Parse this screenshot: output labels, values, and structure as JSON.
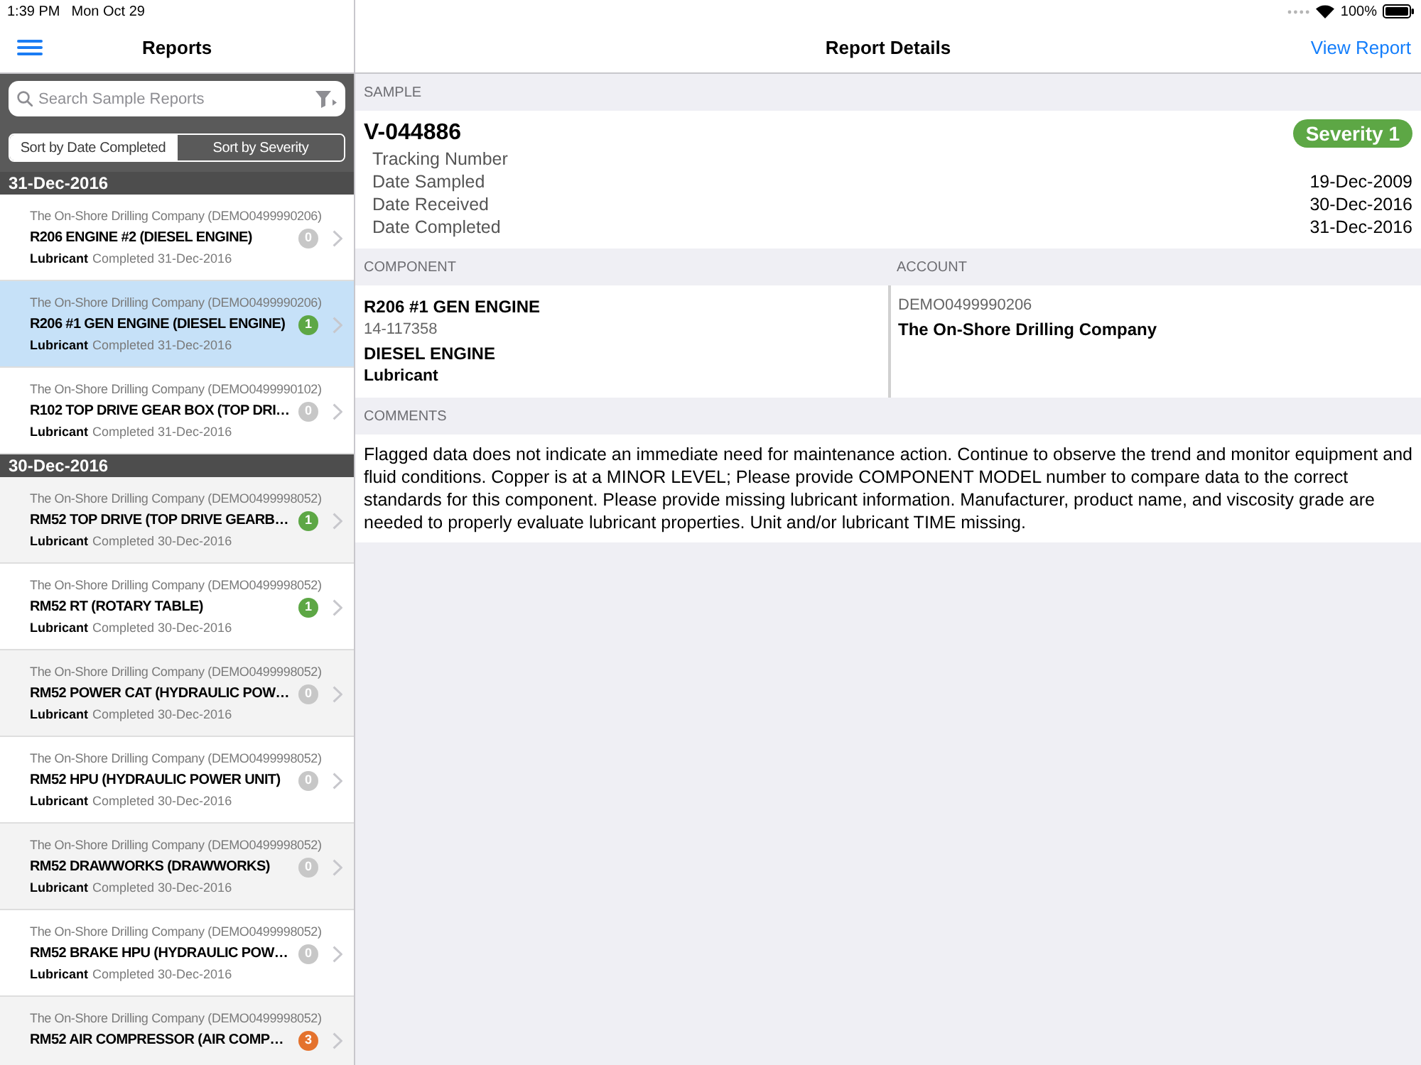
{
  "status_bar": {
    "time": "1:39 PM",
    "date": "Mon Oct 29",
    "battery": "100%"
  },
  "sidebar": {
    "title": "Reports",
    "search": {
      "placeholder": "Search Sample Reports"
    },
    "sort_options": [
      {
        "label": "Sort by Date Completed",
        "selected": true
      },
      {
        "label": "Sort by Severity",
        "selected": false
      }
    ],
    "groups": [
      {
        "date": "31-Dec-2016",
        "reports": [
          {
            "company": "The On-Shore Drilling Company (DEMO0499990206)",
            "title": "R206 ENGINE #2 (DIESEL ENGINE)",
            "count": "0",
            "color": "#c7c7c7",
            "fluid": "Lubricant",
            "status": "Completed 31-Dec-2016",
            "selected": false
          },
          {
            "company": "The On-Shore Drilling Company (DEMO0499990206)",
            "title": "R206 #1 GEN ENGINE (DIESEL ENGINE)",
            "count": "1",
            "color": "#5da745",
            "fluid": "Lubricant",
            "status": "Completed 31-Dec-2016",
            "selected": true
          },
          {
            "company": "The On-Shore Drilling Company (DEMO0499990102)",
            "title": "R102 TOP DRIVE GEAR BOX (TOP DRI…",
            "count": "0",
            "color": "#c7c7c7",
            "fluid": "Lubricant",
            "status": "Completed 31-Dec-2016",
            "selected": false
          }
        ]
      },
      {
        "date": "30-Dec-2016",
        "reports": [
          {
            "company": "The On-Shore Drilling Company (DEMO0499998052)",
            "title": "RM52 TOP DRIVE (TOP DRIVE GEARB…",
            "count": "1",
            "color": "#5da745",
            "fluid": "Lubricant",
            "status": "Completed 30-Dec-2016",
            "selected": false
          },
          {
            "company": "The On-Shore Drilling Company (DEMO0499998052)",
            "title": "RM52 RT (ROTARY TABLE)",
            "count": "1",
            "color": "#5da745",
            "fluid": "Lubricant",
            "status": "Completed 30-Dec-2016",
            "selected": false
          },
          {
            "company": "The On-Shore Drilling Company (DEMO0499998052)",
            "title": "RM52 POWER CAT (HYDRAULIC POW…",
            "count": "0",
            "color": "#c7c7c7",
            "fluid": "Lubricant",
            "status": "Completed 30-Dec-2016",
            "selected": false
          },
          {
            "company": "The On-Shore Drilling Company (DEMO0499998052)",
            "title": "RM52 HPU (HYDRAULIC POWER UNIT)",
            "count": "0",
            "color": "#c7c7c7",
            "fluid": "Lubricant",
            "status": "Completed 30-Dec-2016",
            "selected": false
          },
          {
            "company": "The On-Shore Drilling Company (DEMO0499998052)",
            "title": "RM52 DRAWWORKS (DRAWWORKS)",
            "count": "0",
            "color": "#c7c7c7",
            "fluid": "Lubricant",
            "status": "Completed 30-Dec-2016",
            "selected": false
          },
          {
            "company": "The On-Shore Drilling Company (DEMO0499998052)",
            "title": "RM52 BRAKE HPU (HYDRAULIC POW…",
            "count": "0",
            "color": "#c7c7c7",
            "fluid": "Lubricant",
            "status": "Completed 30-Dec-2016",
            "selected": false
          },
          {
            "company": "The On-Shore Drilling Company (DEMO0499998052)",
            "title": "RM52 AIR COMPRESSOR (AIR COMP…",
            "count": "3",
            "color": "#e4722d",
            "selected": false
          }
        ]
      }
    ]
  },
  "detail": {
    "title": "Report Details",
    "action": "View Report",
    "sample": {
      "heading": "SAMPLE",
      "id": "V-044886",
      "severity": "Severity 1",
      "fields": [
        {
          "label": "Tracking Number"
        },
        {
          "label": "Date Sampled",
          "value": "19-Dec-2009"
        },
        {
          "label": "Date Received",
          "value": "30-Dec-2016"
        },
        {
          "label": "Date Completed",
          "value": "31-Dec-2016"
        }
      ]
    },
    "component": {
      "heading": "COMPONENT",
      "name": "R206 #1 GEN ENGINE",
      "serial": "14-117358",
      "type": "DIESEL ENGINE",
      "fluid": "Lubricant"
    },
    "account": {
      "heading": "ACCOUNT",
      "number": "DEMO0499990206",
      "name": "The On-Shore Drilling Company"
    },
    "comments": {
      "heading": "COMMENTS",
      "text": "Flagged data does not indicate an immediate need for maintenance action. Continue to observe the trend and monitor equipment and fluid conditions. Copper is at a MINOR LEVEL; Please provide COMPONENT MODEL number to compare data to the correct standards for this component. Please provide missing lubricant information. Manufacturer, product name, and viscosity grade are needed to properly evaluate lubricant properties. Unit and/or lubricant TIME missing."
    }
  }
}
